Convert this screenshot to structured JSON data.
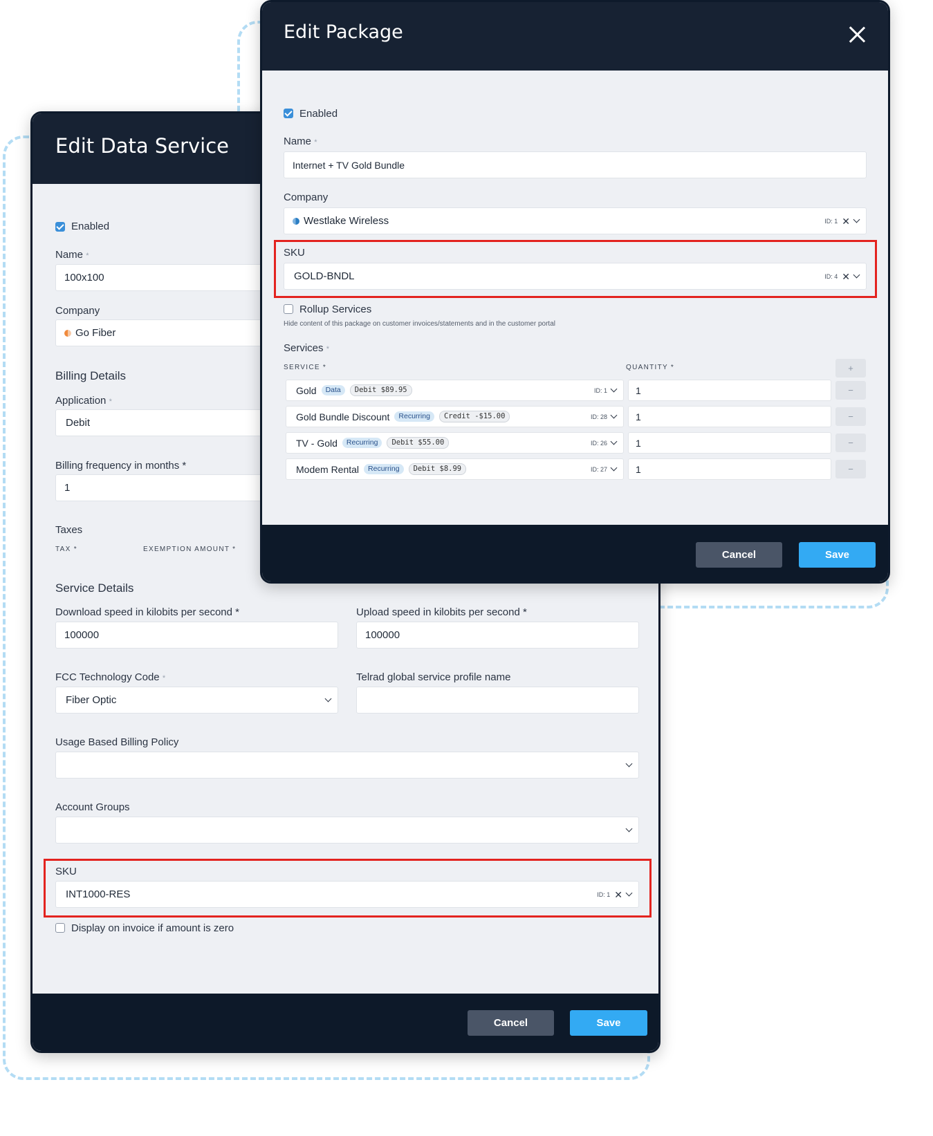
{
  "data_service": {
    "title": "Edit Data Service",
    "enabled_label": "Enabled",
    "name_label": "Name",
    "name_value": "100x100",
    "company_label": "Company",
    "company_value": "Go Fiber",
    "billing_section": "Billing Details",
    "application_label": "Application",
    "application_value": "Debit",
    "billing_freq_label": "Billing frequency in months",
    "billing_freq_value": "1",
    "taxes_label": "Taxes",
    "tax_col": "TAX",
    "exemption_col": "EXEMPTION AMOUNT",
    "service_section": "Service Details",
    "download_label": "Download speed in kilobits per second",
    "download_value": "100000",
    "upload_label": "Upload speed in kilobits per second",
    "upload_value": "100000",
    "fcc_label": "FCC Technology Code",
    "fcc_value": "Fiber Optic",
    "telrad_label": "Telrad global service profile name",
    "telrad_value": "",
    "usage_label": "Usage Based Billing Policy",
    "usage_value": "",
    "groups_label": "Account Groups",
    "groups_value": "",
    "sku_label": "SKU",
    "sku_value": "INT1000-RES",
    "sku_id": "ID: 1",
    "display_zero_label": "Display on invoice if amount is zero",
    "cancel": "Cancel",
    "save": "Save"
  },
  "package": {
    "title": "Edit Package",
    "enabled_label": "Enabled",
    "name_label": "Name",
    "name_value": "Internet + TV Gold Bundle",
    "company_label": "Company",
    "company_value": "Westlake Wireless",
    "company_id": "ID: 1",
    "sku_label": "SKU",
    "sku_value": "GOLD-BNDL",
    "sku_id": "ID: 4",
    "rollup_label": "Rollup Services",
    "rollup_hint": "Hide content of this package on customer invoices/statements and in the customer portal",
    "services_label": "Services",
    "service_col": "SERVICE",
    "quantity_col": "QUANTITY",
    "add_symbol": "+",
    "remove_symbol": "−",
    "services": [
      {
        "name": "Gold",
        "type": "Data",
        "price": "Debit $89.95",
        "id": "ID: 1",
        "qty": "1"
      },
      {
        "name": "Gold Bundle Discount",
        "type": "Recurring",
        "price": "Credit -$15.00",
        "id": "ID: 28",
        "qty": "1"
      },
      {
        "name": "TV - Gold",
        "type": "Recurring",
        "price": "Debit $55.00",
        "id": "ID: 26",
        "qty": "1"
      },
      {
        "name": "Modem Rental",
        "type": "Recurring",
        "price": "Debit $8.99",
        "id": "ID: 27",
        "qty": "1"
      }
    ],
    "cancel": "Cancel",
    "save": "Save"
  },
  "icons": {
    "close": "close-icon",
    "chevron": "chevron-down-icon",
    "clear": "clear-icon",
    "checkbox": "checkbox"
  },
  "colors": {
    "header": "#172233",
    "footer": "#0d1929",
    "save": "#33aaf3",
    "cancel": "#4a5567",
    "highlight": "#e3231f",
    "dash": "#b3dcf4",
    "company_go_fiber": "#f08a3c",
    "company_westlake": "#2c7fc4"
  }
}
